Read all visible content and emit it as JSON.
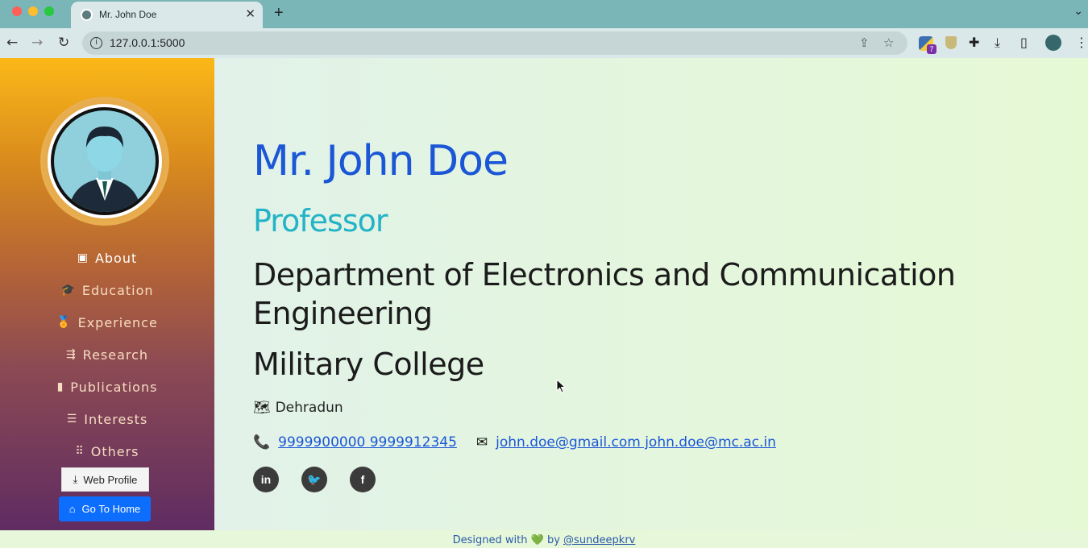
{
  "browser": {
    "tab_title": "Mr. John Doe",
    "tab_close": "✕",
    "new_tab": "+",
    "url": "127.0.0.1:5000",
    "extension_badge": "7"
  },
  "sidebar": {
    "nav": [
      {
        "label": "About",
        "icon": "id-card-icon",
        "glyph": "▣",
        "active": true
      },
      {
        "label": "Education",
        "icon": "graduation-cap-icon",
        "glyph": "🎓",
        "active": false
      },
      {
        "label": "Experience",
        "icon": "award-icon",
        "glyph": "🏅",
        "active": false
      },
      {
        "label": "Research",
        "icon": "signs-icon",
        "glyph": "⇶",
        "active": false
      },
      {
        "label": "Publications",
        "icon": "book-icon",
        "glyph": "▮",
        "active": false
      },
      {
        "label": "Interests",
        "icon": "list-check-icon",
        "glyph": "☰",
        "active": false
      },
      {
        "label": "Others",
        "icon": "grip-icon",
        "glyph": "⠿",
        "active": false
      }
    ],
    "web_profile_label": "Web Profile",
    "home_label": "Go To Home"
  },
  "profile": {
    "name": "Mr. John Doe",
    "role": "Professor",
    "department": "Department of Electronics and Communication Engineering",
    "college": "Military College",
    "location": "Dehradun",
    "phones": "9999900000 9999912345",
    "emails": "john.doe@gmail.com john.doe@mc.ac.in",
    "social": [
      {
        "name": "linkedin",
        "glyph": "in"
      },
      {
        "name": "twitter",
        "glyph": "🐦"
      },
      {
        "name": "facebook",
        "glyph": "f"
      }
    ]
  },
  "footer": {
    "prefix": "Designed with",
    "heart": "💚",
    "by": "by",
    "handle": "@sundeepkrv"
  },
  "colors": {
    "accent": "#1a56d6",
    "role": "#23b3c6",
    "home_button": "#0d6efd"
  }
}
